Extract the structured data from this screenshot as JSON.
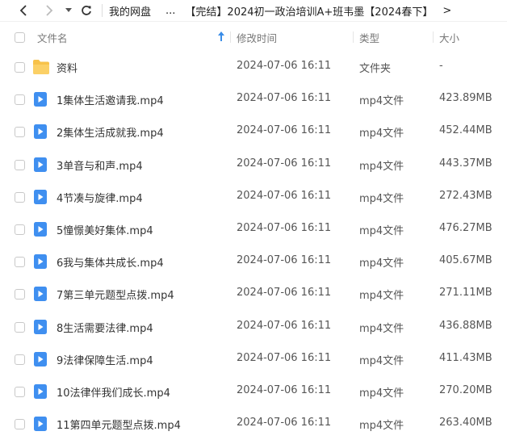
{
  "breadcrumb": {
    "root": "我的网盘",
    "ellipsis": "...",
    "current": "【完结】2024初一政治培训A+班韦墨【2024春下】",
    "more": ">"
  },
  "columns": {
    "name": "文件名",
    "modified": "修改时间",
    "type": "类型",
    "size": "大小"
  },
  "files": [
    {
      "name": "资料",
      "modified": "2024-07-06 16:11",
      "type": "文件夹",
      "size": "-",
      "kind": "folder"
    },
    {
      "name": "1集体生活邀请我.mp4",
      "modified": "2024-07-06 16:11",
      "type": "mp4文件",
      "size": "423.89MB",
      "kind": "video"
    },
    {
      "name": "2集体生活成就我.mp4",
      "modified": "2024-07-06 16:11",
      "type": "mp4文件",
      "size": "452.44MB",
      "kind": "video"
    },
    {
      "name": "3单音与和声.mp4",
      "modified": "2024-07-06 16:11",
      "type": "mp4文件",
      "size": "443.37MB",
      "kind": "video"
    },
    {
      "name": "4节凑与旋律.mp4",
      "modified": "2024-07-06 16:11",
      "type": "mp4文件",
      "size": "272.43MB",
      "kind": "video"
    },
    {
      "name": "5憧憬美好集体.mp4",
      "modified": "2024-07-06 16:11",
      "type": "mp4文件",
      "size": "476.27MB",
      "kind": "video"
    },
    {
      "name": "6我与集体共成长.mp4",
      "modified": "2024-07-06 16:11",
      "type": "mp4文件",
      "size": "405.67MB",
      "kind": "video"
    },
    {
      "name": "7第三单元题型点拨.mp4",
      "modified": "2024-07-06 16:11",
      "type": "mp4文件",
      "size": "271.11MB",
      "kind": "video"
    },
    {
      "name": "8生活需要法律.mp4",
      "modified": "2024-07-06 16:11",
      "type": "mp4文件",
      "size": "436.88MB",
      "kind": "video"
    },
    {
      "name": "9法律保障生活.mp4",
      "modified": "2024-07-06 16:11",
      "type": "mp4文件",
      "size": "411.43MB",
      "kind": "video"
    },
    {
      "name": "10法律伴我们成长.mp4",
      "modified": "2024-07-06 16:11",
      "type": "mp4文件",
      "size": "270.20MB",
      "kind": "video"
    },
    {
      "name": "11第四单元题型点拨.mp4",
      "modified": "2024-07-06 16:11",
      "type": "mp4文件",
      "size": "263.40MB",
      "kind": "video"
    }
  ],
  "icons": {
    "back": "chevron-left-icon",
    "forward": "chevron-right-icon",
    "dropdown": "caret-down-icon",
    "refresh": "refresh-icon",
    "sort": "sort-up-icon",
    "folder": "folder-icon",
    "video": "video-file-icon"
  },
  "colors": {
    "accent": "#3a8de8",
    "folder": "#f7c24a",
    "video": "#3f8ff0"
  }
}
